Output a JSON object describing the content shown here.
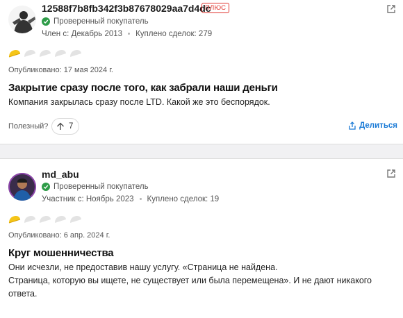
{
  "reviews": [
    {
      "username": "12588f7b8fb342f3b87678029aa7d4dc",
      "badge": "ПЛЮС",
      "verified_label": "Проверенный покупатель",
      "member_since": "Член с: Декабрь 2013",
      "purchases": "Куплено сделок: 279",
      "rating": 1,
      "rating_max": 5,
      "published": "Опубликовано: 17 мая 2024 г.",
      "title": "Закрытие сразу после того, как забрали наши деньги",
      "body": "Компания закрылась сразу после LTD. Какой же это беспорядок.",
      "helpful_label": "Полезный?",
      "helpful_count": "7",
      "share_label": "Делиться"
    },
    {
      "username": "md_abu",
      "verified_label": "Проверенный покупатель",
      "member_since": "Участник с: Ноябрь 2023",
      "purchases": "Куплено сделок: 19",
      "rating": 1,
      "rating_max": 5,
      "published": "Опубликовано: 6 апр. 2024 г.",
      "title": "Круг мошенничества",
      "body_line1": "Они исчезли, не предоставив нашу услугу. «Страница не найдена.",
      "body_line2": "Страница, которую вы ищете, не существует или была перемещена». И не дают никакого",
      "body_line3": "ответа."
    }
  ],
  "colors": {
    "rating_active": "#f5c518",
    "rating_inactive": "#e3e3e3",
    "verified": "#2e9c48",
    "link": "#1a7ad6",
    "badge": "#e0312a"
  },
  "icons": [
    "external-link-icon",
    "check-icon",
    "taco-rating-icon",
    "upvote-arrow-icon",
    "share-icon"
  ]
}
